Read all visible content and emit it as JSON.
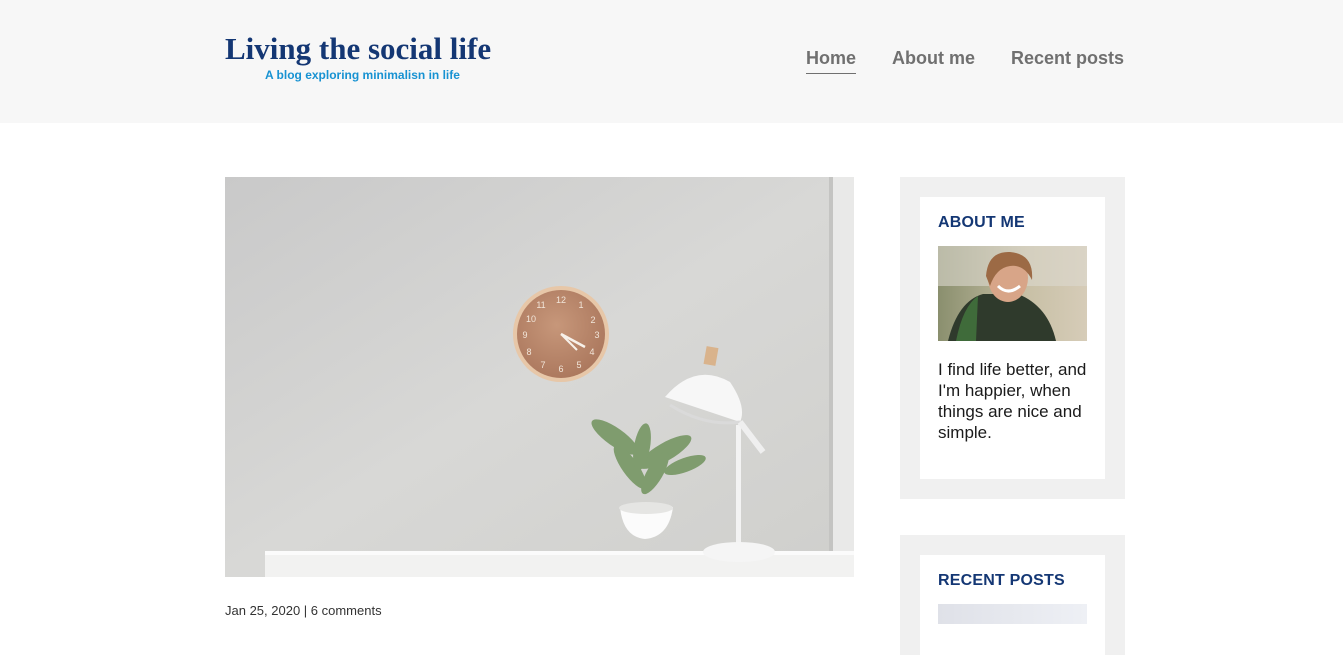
{
  "header": {
    "site_title": "Living the social life",
    "tagline": "A blog exploring minimalisn in life",
    "nav": [
      {
        "label": "Home",
        "active": true
      },
      {
        "label": "About me",
        "active": false
      },
      {
        "label": "Recent posts",
        "active": false
      }
    ]
  },
  "post": {
    "image_subject": "minimalist desk with wall clock, plant and lamp",
    "meta": "Jan 25, 2020 | 6 comments"
  },
  "sidebar": {
    "about": {
      "title": "ABOUT ME",
      "image_subject": "smiling man with backpack",
      "text": "I find life better, and I'm happier, when things are nice and simple."
    },
    "recent_posts": {
      "title": "RECENT POSTS"
    }
  },
  "colors": {
    "brand": "#143774",
    "accent": "#1792d2",
    "nav_text": "#707070",
    "header_bg": "#f7f7f7",
    "widget_bg": "#f0f0f0"
  }
}
